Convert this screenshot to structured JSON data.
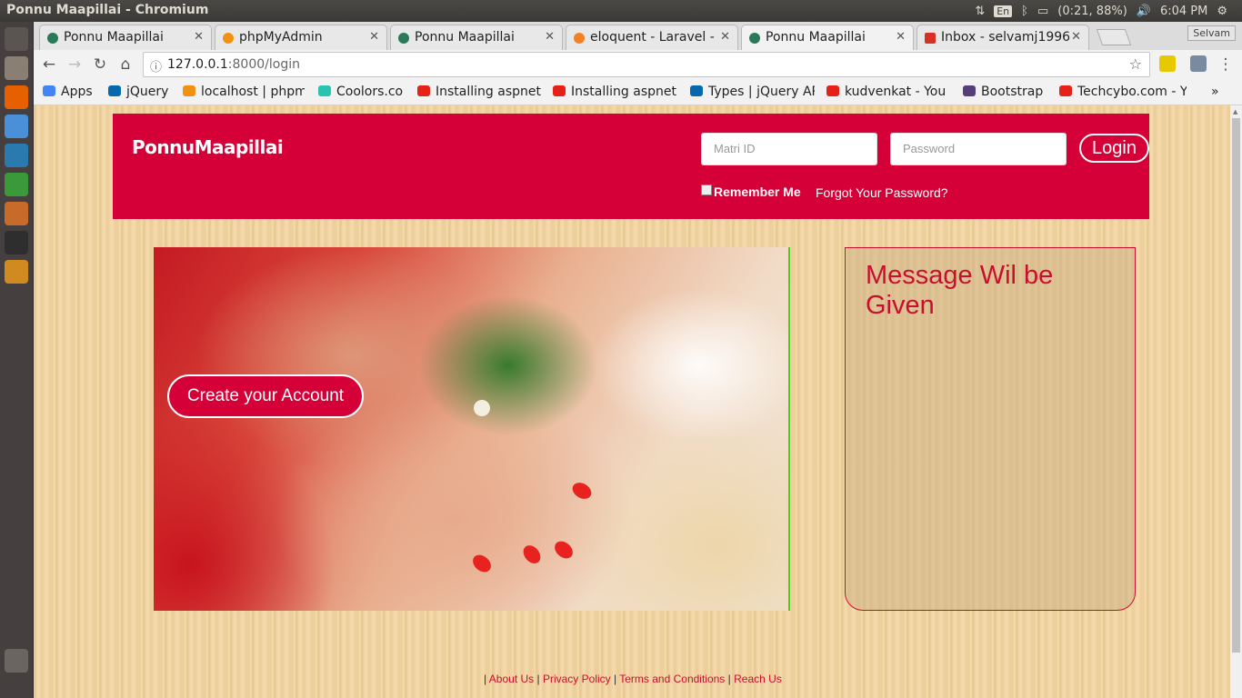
{
  "window": {
    "title": "Ponnu Maapillai - Chromium"
  },
  "tray": {
    "lang": "En",
    "battery": "(0:21, 88%)",
    "time": "6:04 PM"
  },
  "browser": {
    "profile": "Selvam",
    "tabs": [
      {
        "label": "Ponnu Maapillai",
        "color": "#2a7a5a"
      },
      {
        "label": "phpMyAdmin",
        "color": "#f29111"
      },
      {
        "label": "Ponnu Maapillai",
        "color": "#2a7a5a"
      },
      {
        "label": "eloquent - Laravel -",
        "color": "#f48024"
      },
      {
        "label": "Ponnu Maapillai",
        "color": "#2a7a5a"
      },
      {
        "label": "Inbox - selvamj1996",
        "color": "#d93025"
      }
    ],
    "url_host": "127.0.0.1",
    "url_rest": ":8000/login",
    "bookmarks": [
      {
        "label": "Apps",
        "color": "#4285f4"
      },
      {
        "label": "jQuery",
        "color": "#0769ad"
      },
      {
        "label": "localhost | phpm",
        "color": "#f29111"
      },
      {
        "label": "Coolors.co",
        "color": "#27c4b0"
      },
      {
        "label": "Installing aspnet",
        "color": "#e62117"
      },
      {
        "label": "Installing aspnet",
        "color": "#e62117"
      },
      {
        "label": "Types | jQuery AP",
        "color": "#0769ad"
      },
      {
        "label": "kudvenkat - You",
        "color": "#e62117"
      },
      {
        "label": "Bootstrap",
        "color": "#563d7c"
      },
      {
        "label": "Techcybo.com - Y",
        "color": "#e62117"
      }
    ]
  },
  "site": {
    "logo": "PonnuMaapillai",
    "matri_placeholder": "Matri ID",
    "password_placeholder": "Password",
    "login_label": "Login",
    "remember_label": "Remember Me",
    "forgot_label": "Forgot Your Password?",
    "create_account_label": "Create your Account",
    "message": "Message Wil be Given",
    "footer": {
      "sep": "|",
      "links": [
        "About Us",
        "Privacy Policy",
        "Terms and Conditions",
        "Reach Us"
      ]
    },
    "colors": {
      "brand": "#d40037",
      "accent_border": "#4ccf1a"
    }
  }
}
